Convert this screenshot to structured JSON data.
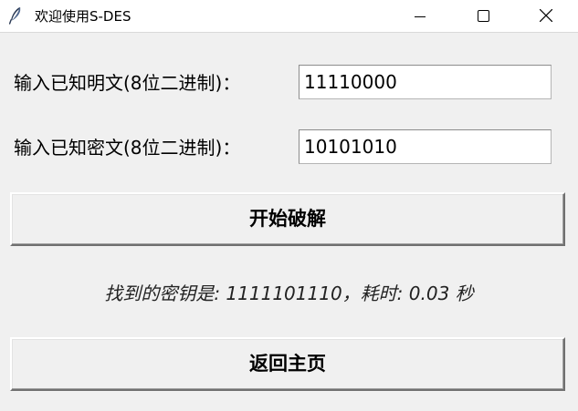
{
  "window": {
    "title": "欢迎使用S-DES",
    "icons": {
      "app": "feather-icon",
      "minimize": "minimize-icon",
      "maximize": "maximize-icon",
      "close": "close-icon"
    }
  },
  "form": {
    "plaintext_label": "输入已知明文(8位二进制)：",
    "plaintext_value": "11110000",
    "ciphertext_label": "输入已知密文(8位二进制)：",
    "ciphertext_value": "10101010"
  },
  "actions": {
    "crack_label": "开始破解",
    "home_label": "返回主页"
  },
  "result": {
    "text": "找到的密钥是: 1111101110，耗时: 0.03 秒"
  }
}
